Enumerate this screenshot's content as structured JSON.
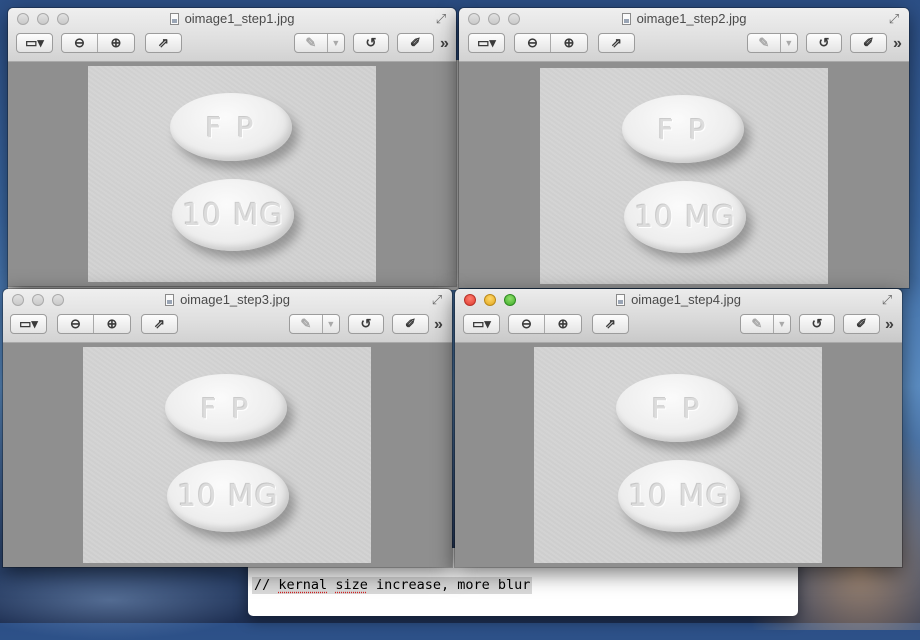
{
  "editor": {
    "line_parts": [
      "// ",
      "kernal",
      " ",
      "size",
      " increase, more blur"
    ]
  },
  "windows": [
    {
      "title": "oimage1_step1.jpg",
      "active": false,
      "imprint_top": "F P",
      "imprint_bottom": "10 MG"
    },
    {
      "title": "oimage1_step2.jpg",
      "active": false,
      "imprint_top": "F P",
      "imprint_bottom": "10 MG"
    },
    {
      "title": "oimage1_step3.jpg",
      "active": false,
      "imprint_top": "F P",
      "imprint_bottom": "10 MG"
    },
    {
      "title": "oimage1_step4.jpg",
      "active": true,
      "imprint_top": "F P",
      "imprint_bottom": "10 MG"
    }
  ],
  "toolbar": {
    "icons": [
      "sidebar-icon",
      "zoom-out-icon",
      "zoom-in-icon",
      "share-icon",
      "markup-pen-icon",
      "rotate-icon",
      "edit-icon",
      "more-chevron-icon"
    ]
  },
  "colors": {
    "background_gray": "#8f8f8f",
    "close": "#dd3b2f",
    "minimize": "#e0a51e",
    "zoom": "#3faa2a"
  }
}
